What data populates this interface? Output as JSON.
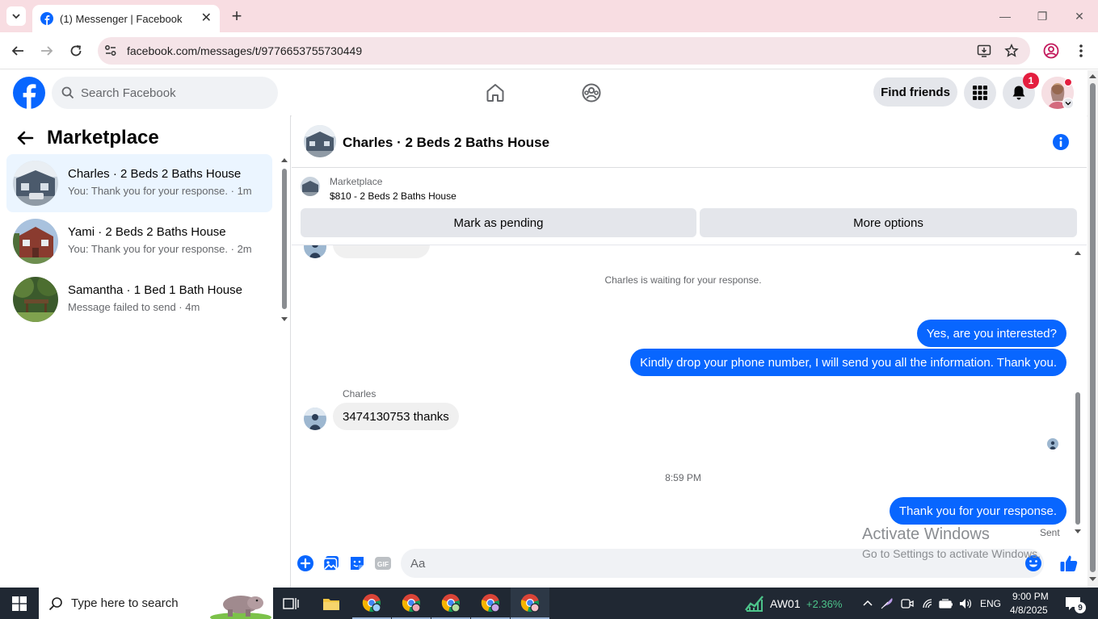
{
  "browser": {
    "tab_title": "(1) Messenger | Facebook",
    "url": "facebook.com/messages/t/9776653755730449"
  },
  "fb_header": {
    "search_placeholder": "Search Facebook",
    "find_friends": "Find friends",
    "notification_count": "1"
  },
  "sidebar": {
    "title": "Marketplace",
    "conversations": [
      {
        "name": "Charles · 2 Beds 2 Baths House",
        "preview": "You: Thank you for your response. · 1m",
        "active": true
      },
      {
        "name": "Yami · 2 Beds 2 Baths House",
        "preview": "You: Thank you for your response. · 2m",
        "active": false
      },
      {
        "name": "Samantha · 1 Bed 1 Bath House",
        "preview": "Message failed to send · 4m",
        "active": false
      }
    ]
  },
  "chat": {
    "title": "Charles · 2 Beds 2 Baths House",
    "marketplace_label": "Marketplace",
    "listing": "$810 - 2 Beds 2 Baths House",
    "mark_pending": "Mark as pending",
    "more_options": "More options",
    "waiting_text": "Charles is waiting for your response.",
    "messages": [
      {
        "from": "me",
        "text": "Yes, are you interested?"
      },
      {
        "from": "me",
        "text": "Kindly drop your phone number, I will send you all the information. Thank you."
      },
      {
        "from": "Charles",
        "sender_label": "Charles",
        "text": "3474130753 thanks"
      },
      {
        "from": "me",
        "text": "Thank you for your response."
      }
    ],
    "timestamp": "8:59 PM",
    "sent_status": "Sent",
    "composer_placeholder": "Aa"
  },
  "watermark": {
    "line1": "Activate Windows",
    "line2": "Go to Settings to activate Windows."
  },
  "taskbar": {
    "search_text": "Type here to search",
    "stock_name": "AW01",
    "stock_change": "+2.36%",
    "language": "ENG",
    "time": "9:00 PM",
    "date": "4/8/2025",
    "notification_count": "9"
  },
  "colors": {
    "accent": "#0866ff",
    "tabstrip": "#f8dde2",
    "taskbar": "#202833",
    "stock_green": "#4cc38a"
  }
}
